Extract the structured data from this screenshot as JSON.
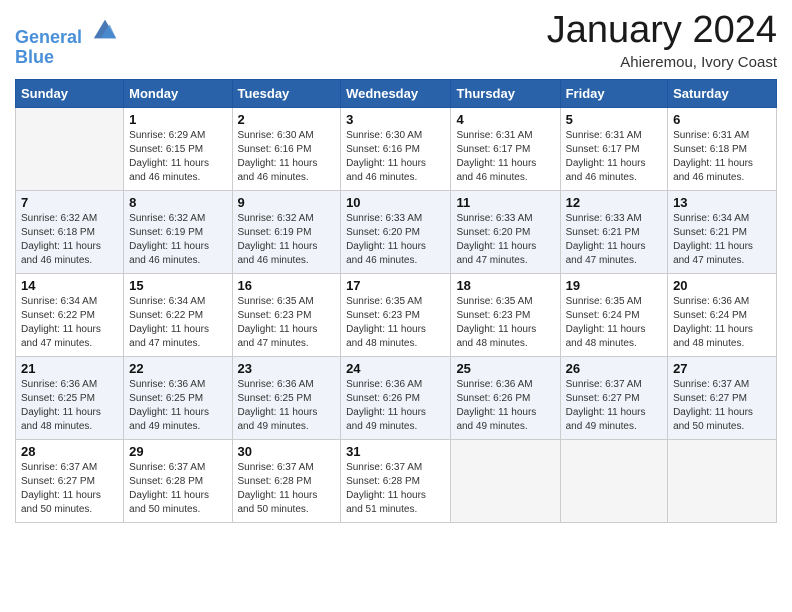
{
  "header": {
    "logo_line1": "General",
    "logo_line2": "Blue",
    "month": "January 2024",
    "location": "Ahieremou, Ivory Coast"
  },
  "weekdays": [
    "Sunday",
    "Monday",
    "Tuesday",
    "Wednesday",
    "Thursday",
    "Friday",
    "Saturday"
  ],
  "weeks": [
    [
      {
        "day": "",
        "info": ""
      },
      {
        "day": "1",
        "info": "Sunrise: 6:29 AM\nSunset: 6:15 PM\nDaylight: 11 hours\nand 46 minutes."
      },
      {
        "day": "2",
        "info": "Sunrise: 6:30 AM\nSunset: 6:16 PM\nDaylight: 11 hours\nand 46 minutes."
      },
      {
        "day": "3",
        "info": "Sunrise: 6:30 AM\nSunset: 6:16 PM\nDaylight: 11 hours\nand 46 minutes."
      },
      {
        "day": "4",
        "info": "Sunrise: 6:31 AM\nSunset: 6:17 PM\nDaylight: 11 hours\nand 46 minutes."
      },
      {
        "day": "5",
        "info": "Sunrise: 6:31 AM\nSunset: 6:17 PM\nDaylight: 11 hours\nand 46 minutes."
      },
      {
        "day": "6",
        "info": "Sunrise: 6:31 AM\nSunset: 6:18 PM\nDaylight: 11 hours\nand 46 minutes."
      }
    ],
    [
      {
        "day": "7",
        "info": "Sunrise: 6:32 AM\nSunset: 6:18 PM\nDaylight: 11 hours\nand 46 minutes."
      },
      {
        "day": "8",
        "info": "Sunrise: 6:32 AM\nSunset: 6:19 PM\nDaylight: 11 hours\nand 46 minutes."
      },
      {
        "day": "9",
        "info": "Sunrise: 6:32 AM\nSunset: 6:19 PM\nDaylight: 11 hours\nand 46 minutes."
      },
      {
        "day": "10",
        "info": "Sunrise: 6:33 AM\nSunset: 6:20 PM\nDaylight: 11 hours\nand 46 minutes."
      },
      {
        "day": "11",
        "info": "Sunrise: 6:33 AM\nSunset: 6:20 PM\nDaylight: 11 hours\nand 47 minutes."
      },
      {
        "day": "12",
        "info": "Sunrise: 6:33 AM\nSunset: 6:21 PM\nDaylight: 11 hours\nand 47 minutes."
      },
      {
        "day": "13",
        "info": "Sunrise: 6:34 AM\nSunset: 6:21 PM\nDaylight: 11 hours\nand 47 minutes."
      }
    ],
    [
      {
        "day": "14",
        "info": "Sunrise: 6:34 AM\nSunset: 6:22 PM\nDaylight: 11 hours\nand 47 minutes."
      },
      {
        "day": "15",
        "info": "Sunrise: 6:34 AM\nSunset: 6:22 PM\nDaylight: 11 hours\nand 47 minutes."
      },
      {
        "day": "16",
        "info": "Sunrise: 6:35 AM\nSunset: 6:23 PM\nDaylight: 11 hours\nand 47 minutes."
      },
      {
        "day": "17",
        "info": "Sunrise: 6:35 AM\nSunset: 6:23 PM\nDaylight: 11 hours\nand 48 minutes."
      },
      {
        "day": "18",
        "info": "Sunrise: 6:35 AM\nSunset: 6:23 PM\nDaylight: 11 hours\nand 48 minutes."
      },
      {
        "day": "19",
        "info": "Sunrise: 6:35 AM\nSunset: 6:24 PM\nDaylight: 11 hours\nand 48 minutes."
      },
      {
        "day": "20",
        "info": "Sunrise: 6:36 AM\nSunset: 6:24 PM\nDaylight: 11 hours\nand 48 minutes."
      }
    ],
    [
      {
        "day": "21",
        "info": "Sunrise: 6:36 AM\nSunset: 6:25 PM\nDaylight: 11 hours\nand 48 minutes."
      },
      {
        "day": "22",
        "info": "Sunrise: 6:36 AM\nSunset: 6:25 PM\nDaylight: 11 hours\nand 49 minutes."
      },
      {
        "day": "23",
        "info": "Sunrise: 6:36 AM\nSunset: 6:25 PM\nDaylight: 11 hours\nand 49 minutes."
      },
      {
        "day": "24",
        "info": "Sunrise: 6:36 AM\nSunset: 6:26 PM\nDaylight: 11 hours\nand 49 minutes."
      },
      {
        "day": "25",
        "info": "Sunrise: 6:36 AM\nSunset: 6:26 PM\nDaylight: 11 hours\nand 49 minutes."
      },
      {
        "day": "26",
        "info": "Sunrise: 6:37 AM\nSunset: 6:27 PM\nDaylight: 11 hours\nand 49 minutes."
      },
      {
        "day": "27",
        "info": "Sunrise: 6:37 AM\nSunset: 6:27 PM\nDaylight: 11 hours\nand 50 minutes."
      }
    ],
    [
      {
        "day": "28",
        "info": "Sunrise: 6:37 AM\nSunset: 6:27 PM\nDaylight: 11 hours\nand 50 minutes."
      },
      {
        "day": "29",
        "info": "Sunrise: 6:37 AM\nSunset: 6:28 PM\nDaylight: 11 hours\nand 50 minutes."
      },
      {
        "day": "30",
        "info": "Sunrise: 6:37 AM\nSunset: 6:28 PM\nDaylight: 11 hours\nand 50 minutes."
      },
      {
        "day": "31",
        "info": "Sunrise: 6:37 AM\nSunset: 6:28 PM\nDaylight: 11 hours\nand 51 minutes."
      },
      {
        "day": "",
        "info": ""
      },
      {
        "day": "",
        "info": ""
      },
      {
        "day": "",
        "info": ""
      }
    ]
  ]
}
